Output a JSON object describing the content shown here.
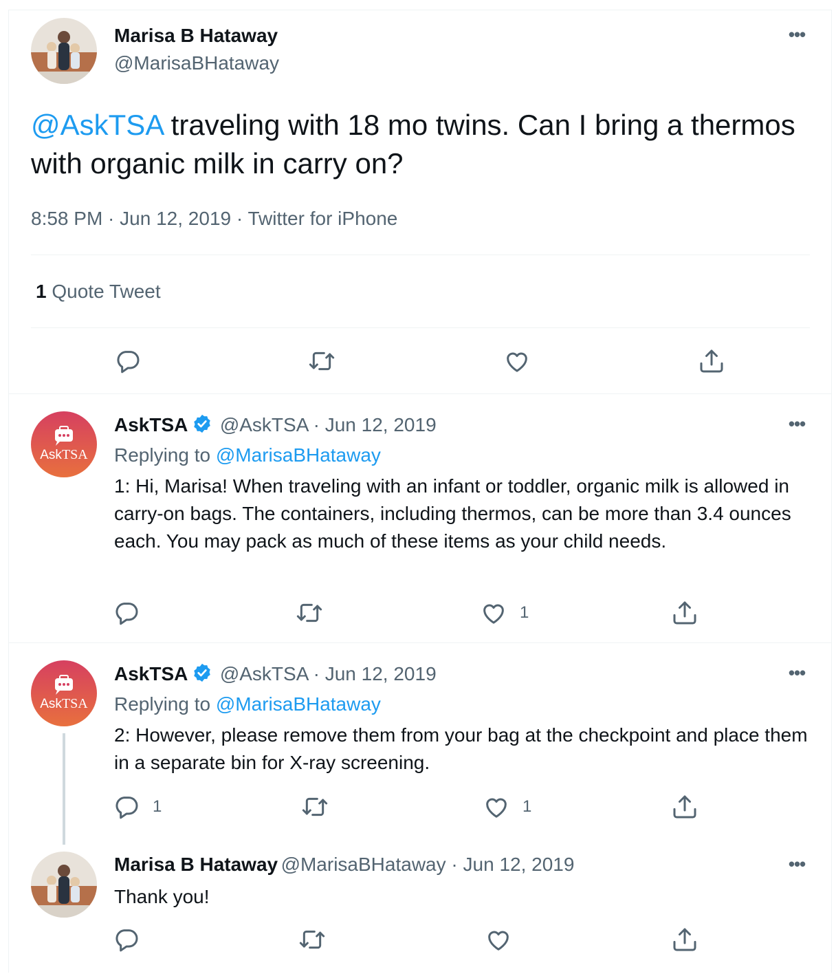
{
  "main_tweet": {
    "author_name": "Marisa B Hataway",
    "author_handle": "@MarisaBHataway",
    "mention": "@AskTSA",
    "text": " traveling with 18 mo twins. Can I bring a thermos with organic milk in carry on?",
    "time": "8:58 PM",
    "date": "Jun 12, 2019",
    "source": "Twitter for iPhone",
    "quote_count": "1",
    "quote_label": "Quote Tweet"
  },
  "replies": [
    {
      "author_name": "AskTSA",
      "author_handle": "@AskTSA",
      "date": "Jun 12, 2019",
      "replying_label": "Replying to",
      "replying_handle": "@MarisaBHataway",
      "text": "1: Hi, Marisa! When traveling with an infant or toddler, organic milk is allowed in carry-on bags. The containers, including thermos, can be more than 3.4 ounces each. You may pack as much of these items as your child needs.",
      "reply_count": "",
      "like_count": "1"
    },
    {
      "author_name": "AskTSA",
      "author_handle": "@AskTSA",
      "date": "Jun 12, 2019",
      "replying_label": "Replying to",
      "replying_handle": "@MarisaBHataway",
      "text": "2: However, please remove them from your bag at the checkpoint and place them in a separate bin for X-ray screening.",
      "reply_count": "1",
      "like_count": "1"
    },
    {
      "author_name": "Marisa B Hataway",
      "author_handle": "@MarisaBHataway",
      "date": "Jun 12, 2019",
      "text": "Thank you!",
      "reply_count": "",
      "like_count": ""
    }
  ],
  "asktsa_avatar": {
    "word1": "Ask",
    "word2": "TSA"
  },
  "separator": " · ",
  "more_glyph": "•••",
  "colors": {
    "link": "#1d9bf0",
    "muted": "#536471",
    "text": "#0f1419",
    "verified": "#1d9bf0",
    "divider": "#eff3f4"
  },
  "icons": [
    "more-icon",
    "reply-icon",
    "retweet-icon",
    "like-icon",
    "share-icon",
    "verified-badge-icon"
  ]
}
